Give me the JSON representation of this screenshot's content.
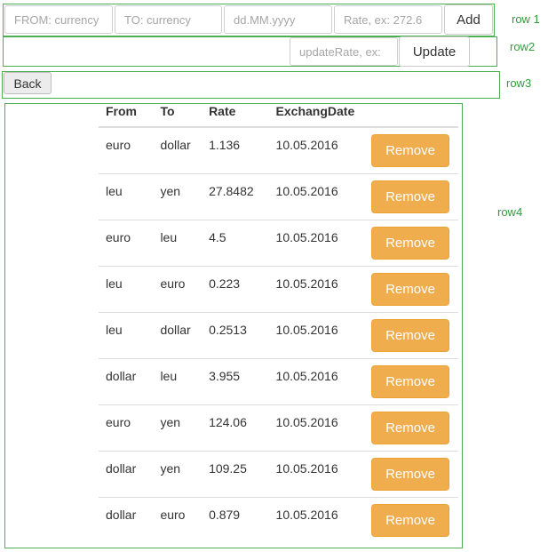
{
  "row1": {
    "label": "row 1",
    "from_placeholder": "FROM: currency",
    "to_placeholder": "TO: currency",
    "date_placeholder": "dd.MM.yyyy",
    "rate_placeholder": "Rate, ex: 272.6",
    "add_label": "Add"
  },
  "row2": {
    "label": "row2",
    "update_rate_placeholder": "updateRate, ex:",
    "update_label": "Update"
  },
  "row3": {
    "label": "row3",
    "back_label": "Back"
  },
  "row4": {
    "label": "row4",
    "table": {
      "columns": [
        "From",
        "To",
        "Rate",
        "ExchangDate"
      ],
      "remove_label": "Remove",
      "rows": [
        {
          "from": "euro",
          "to": "dollar",
          "rate": "1.136",
          "date": "10.05.2016"
        },
        {
          "from": "leu",
          "to": "yen",
          "rate": "27.8482",
          "date": "10.05.2016"
        },
        {
          "from": "euro",
          "to": "leu",
          "rate": "4.5",
          "date": "10.05.2016"
        },
        {
          "from": "leu",
          "to": "euro",
          "rate": "0.223",
          "date": "10.05.2016"
        },
        {
          "from": "leu",
          "to": "dollar",
          "rate": "0.2513",
          "date": "10.05.2016"
        },
        {
          "from": "dollar",
          "to": "leu",
          "rate": "3.955",
          "date": "10.05.2016"
        },
        {
          "from": "euro",
          "to": "yen",
          "rate": "124.06",
          "date": "10.05.2016"
        },
        {
          "from": "dollar",
          "to": "yen",
          "rate": "109.25",
          "date": "10.05.2016"
        },
        {
          "from": "dollar",
          "to": "euro",
          "rate": "0.879",
          "date": "10.05.2016"
        }
      ]
    }
  },
  "colors": {
    "row_border": "#4caf50",
    "row_label": "#2e9d3a",
    "remove_button": "#f0ad4e"
  }
}
